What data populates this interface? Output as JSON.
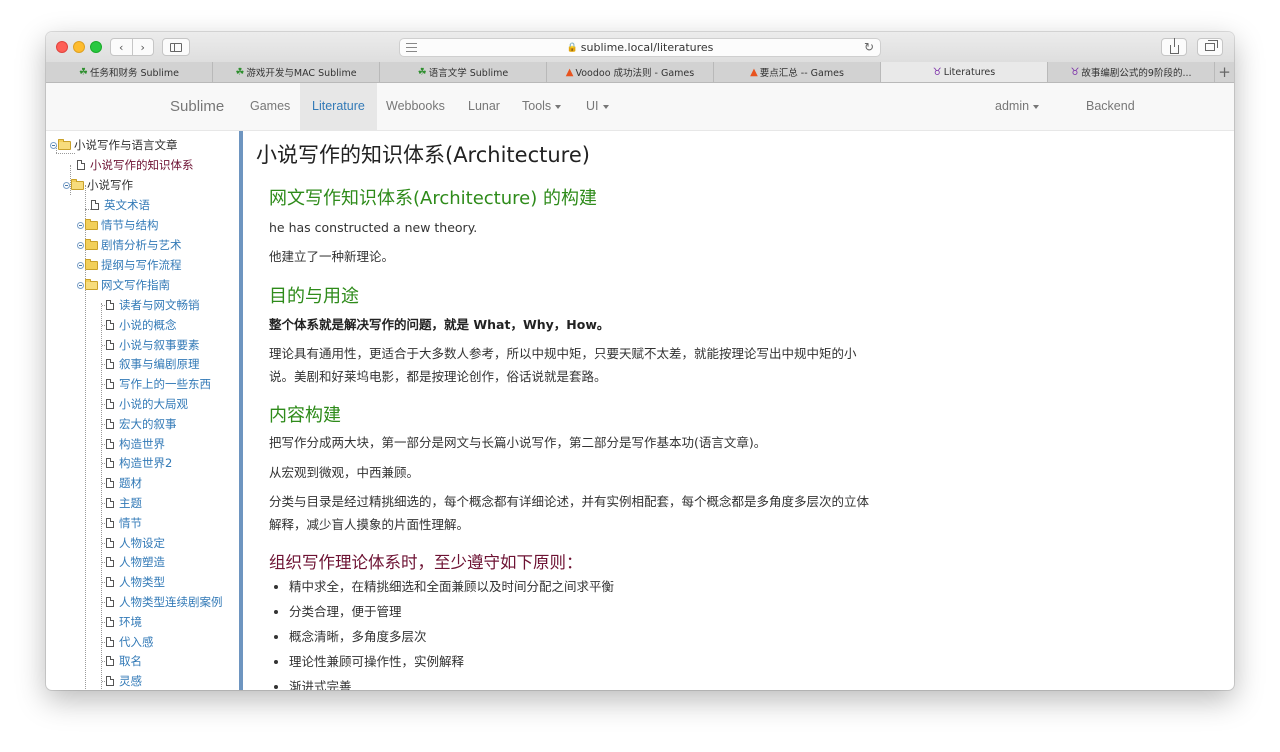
{
  "browser": {
    "url": "sublime.local/literatures",
    "tabs": [
      {
        "icon": "clover",
        "label": "任务和财务 Sublime"
      },
      {
        "icon": "clover",
        "label": "游戏开发与MAC Sublime"
      },
      {
        "icon": "clover",
        "label": "语言文学 Sublime"
      },
      {
        "icon": "flame",
        "label": "Voodoo 成功法则 - Games"
      },
      {
        "icon": "flame",
        "label": "要点汇总 -- Games"
      },
      {
        "icon": "taurus",
        "label": "Literatures"
      },
      {
        "icon": "taurus",
        "label": "故事编剧公式的9阶段的..."
      }
    ],
    "add_tab": "+"
  },
  "navbar": {
    "brand": "Sublime",
    "items": [
      "Games",
      "Literature",
      "Webbooks",
      "Lunar",
      "Tools",
      "UI"
    ],
    "right": [
      "admin",
      "Backend"
    ]
  },
  "tree": {
    "root": "小说写作与语言文章",
    "selected": "小说写作的知识体系",
    "group": "小说写作",
    "english": "英文术语",
    "folders": [
      "情节与结构",
      "剧情分析与艺术",
      "提纲与写作流程"
    ],
    "open_folder": "网文写作指南",
    "docs": [
      "读者与网文畅销",
      "小说的概念",
      "小说与叙事要素",
      "叙事与编剧原理",
      "写作上的一些东西",
      "小说的大局观",
      "宏大的叙事",
      "构造世界",
      "构造世界2",
      "题材",
      "主题",
      "情节",
      "人物设定",
      "人物塑造",
      "人物类型",
      "人物类型连续剧案例",
      "环境",
      "代入感",
      "取名",
      "灵感"
    ]
  },
  "content": {
    "title": "小说写作的知识体系(Architecture)",
    "h_build": "网文写作知识体系(Architecture) 的构建",
    "p_en": "he has constructed a new theory.",
    "p_zh": "他建立了一种新理论。",
    "h_purpose": "目的与用途",
    "p_bold": "整个体系就是解决写作的问题，就是 What，Why，How。",
    "p_theory": "理论具有通用性，更适合于大多数人参考，所以中规中矩，只要天赋不太差，就能按理论写出中规中矩的小说。美剧和好莱坞电影，都是按理论创作，俗话说就是套路。",
    "h_structure": "内容构建",
    "p_parts": "把写作分成两大块，第一部分是网文与长篇小说写作，第二部分是写作基本功(语言文章)。",
    "p_macro": "从宏观到微观，中西兼顾。",
    "p_category": "分类与目录是经过精挑细选的，每个概念都有详细论述，并有实例相配套，每个概念都是多角度多层次的立体解释，减少盲人摸象的片面性理解。",
    "h_principles": "组织写作理论体系时，至少遵守如下原则：",
    "principles": [
      "精中求全，在精挑细选和全面兼顾以及时间分配之间求平衡",
      "分类合理，便于管理",
      "概念清晰，多角度多层次",
      "理论性兼顾可操作性，实例解释",
      "渐进式完善"
    ]
  },
  "colors": {
    "link": "#337ab7",
    "heading_green": "#2e8b1a",
    "heading_maroon": "#6d1233",
    "divider": "#6e95c0"
  }
}
